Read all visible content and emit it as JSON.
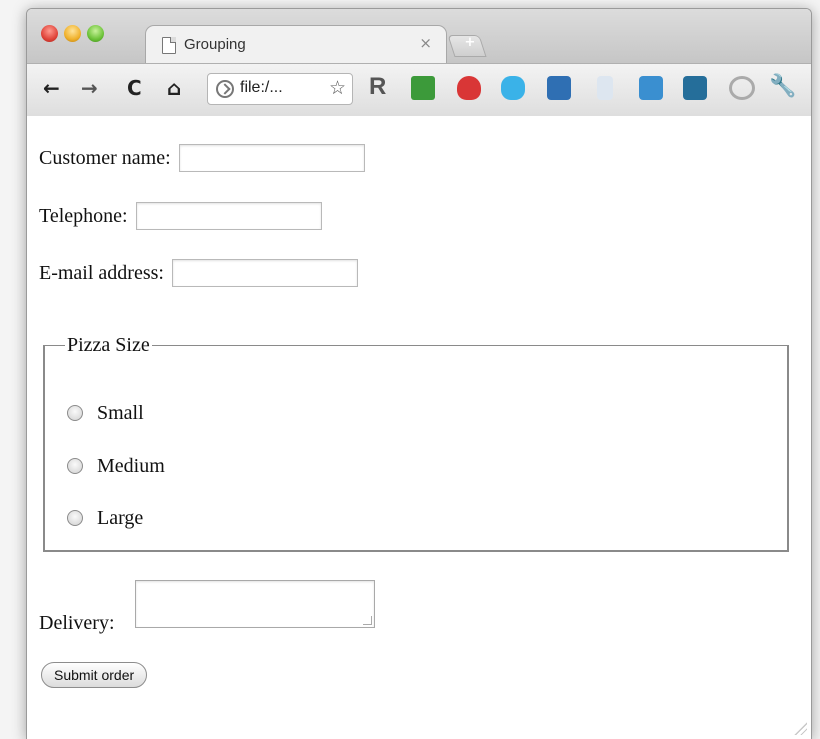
{
  "browser": {
    "tab": {
      "title": "Grouping",
      "close_glyph": "×",
      "icon": "page-icon"
    },
    "new_tab_glyph": "+",
    "toolbar": {
      "back_glyph": "←",
      "forward_glyph": "→",
      "reload_glyph": "C",
      "home_glyph": "⌂",
      "address": "file:/...",
      "bookmark_glyph": "☆",
      "r_extension_label": "R",
      "wrench_glyph": "🔧"
    },
    "colors": {
      "red": "#e0443a",
      "yellow": "#f0b12b",
      "green": "#6cc238"
    }
  },
  "form": {
    "customer_name_label": "Customer name:",
    "telephone_label": "Telephone:",
    "email_label": "E-mail address:",
    "pizza_size": {
      "legend": "Pizza Size",
      "options": [
        {
          "label": "Small"
        },
        {
          "label": "Medium"
        },
        {
          "label": "Large"
        }
      ]
    },
    "delivery_label": "Delivery:",
    "submit_label": "Submit order"
  }
}
